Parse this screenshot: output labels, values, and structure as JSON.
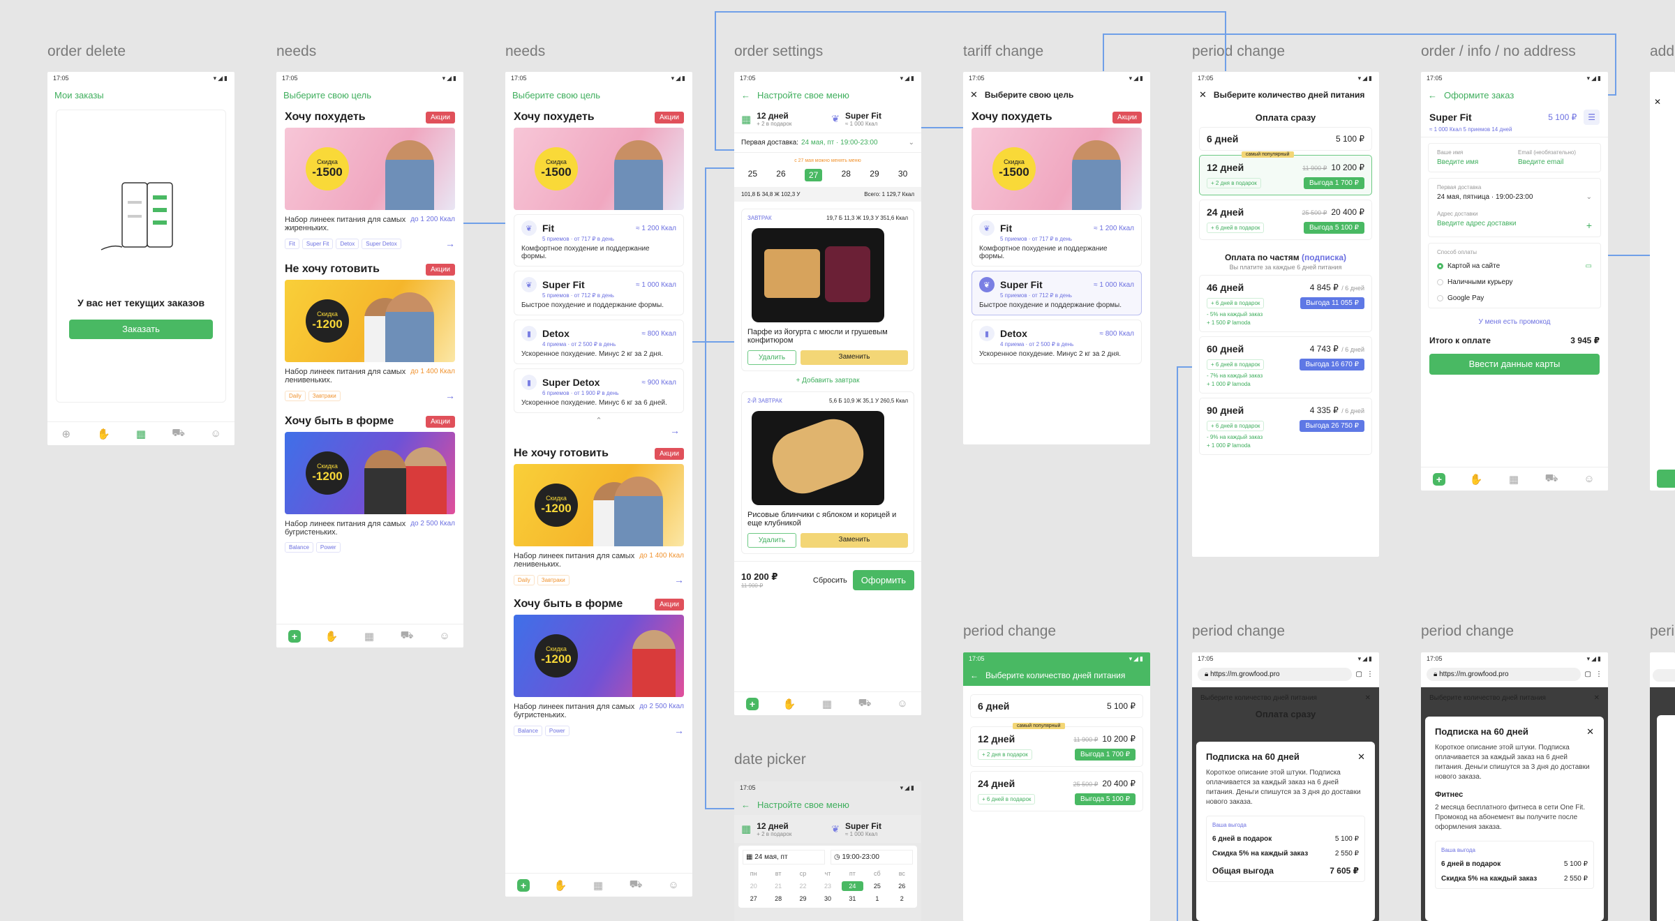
{
  "labels": {
    "f1": "order delete",
    "f2": "needs",
    "f3": "needs",
    "f4": "order settings",
    "f5": "tariff change",
    "f6": "period change",
    "f7": "order / info / no address",
    "f8": "add",
    "f9": "period change",
    "f10": "period change",
    "f11": "period change",
    "f12": "peri",
    "f13": "date picker"
  },
  "status": {
    "time": "17:05",
    "icons": "▾◢▮"
  },
  "colors": {
    "accent": "#49b963",
    "promo": "#e0505a",
    "violet": "#6b6fe0"
  },
  "orders": {
    "title": "Мои заказы",
    "empty": "У вас нет текущих заказов",
    "cta": "Заказать"
  },
  "needs": {
    "title": "Выберите свою цель",
    "promo": "Акции",
    "sections": [
      {
        "title": "Хочу похудеть",
        "disc_label": "Скидка",
        "disc": "-1500",
        "desc": "Набор линеек питания для самых жиренньких.",
        "kcal": "до 1 200 Ккал",
        "chips": [
          "Fit",
          "Super Fit",
          "Detox",
          "Super Detox"
        ]
      },
      {
        "title": "Не хочу готовить",
        "disc_label": "Скидка",
        "disc": "-1200",
        "desc": "Набор линеек питания для самых ленивеньких.",
        "kcal": "до 1 400 Ккал",
        "chips": [
          "Daily",
          "Завтраки"
        ]
      },
      {
        "title": "Хочу быть в форме",
        "disc_label": "Скидка",
        "disc": "-1200",
        "desc": "Набор линеек питания для самых бугристеньких.",
        "kcal": "до 2 500 Ккал",
        "chips": [
          "Balance",
          "Power"
        ]
      }
    ],
    "plans": [
      {
        "name": "Fit",
        "kcal": "≈ 1 200 Ккал",
        "meta": "5 приемов · от 717 ₽ в день",
        "text": "Комфортное похудение и поддержание формы."
      },
      {
        "name": "Super Fit",
        "kcal": "≈ 1 000 Ккал",
        "meta": "5 приемов · от 712 ₽ в день",
        "text": "Быстрое похудение и поддержание формы."
      },
      {
        "name": "Detox",
        "kcal": "≈ 800 Ккал",
        "meta": "4 приема · от 2 500 ₽ в день",
        "text": "Ускоренное похудение. Минус 2 кг за 2 дня."
      },
      {
        "name": "Super Detox",
        "kcal": "≈ 900 Ккал",
        "meta": "6 приемов · от 1 900 ₽ в день",
        "text": "Ускоренное похудение. Минус 6 кг за 6 дней."
      }
    ]
  },
  "settings": {
    "title": "Настройте свое меню",
    "days": "12 дней",
    "days_sub": "+ 2 в подарок",
    "plan": "Super Fit",
    "plan_sub": "≈ 1 000 Ккал",
    "first_label": "Первая доставка:",
    "first_val": "24 мая, пт · 19:00-23:00",
    "hint": "с 27 мая можно менять меню",
    "dates": [
      "25",
      "26",
      "27",
      "28",
      "29",
      "30"
    ],
    "macros": "101,8 Б   34,8 Ж   102,3 У",
    "total": "Всего: 1 129,7 Ккал",
    "meal1": "ЗАВТРАК",
    "meal1_macros": "19,7 Б  11,3 Ж  19,3 У     351,6 Ккал",
    "meal1_name": "Парфе из йогурта с мюсли и грушевым конфитюром",
    "meal2": "2-Й ЗАВТРАК",
    "meal2_macros": "5,6 Б  10,9 Ж  35,1 У     260,5 Ккал",
    "meal2_name": "Рисовые блинчики с яблоком и корицей и еще клубникой",
    "remove": "Удалить",
    "replace": "Заменить",
    "add": "+ Добавить завтрак",
    "price": "10 200 ₽",
    "old": "11 900 ₽",
    "reset": "Сбросить",
    "order": "Оформить"
  },
  "period": {
    "title": "Выберите количество дней питания",
    "pay_now": "Оплата сразу",
    "popular": "самый популярный",
    "now": [
      {
        "d": "6 дней",
        "p": "5 100 ₽",
        "old": "",
        "gift": "",
        "profit": ""
      },
      {
        "d": "12 дней",
        "p": "10 200 ₽",
        "old": "11 900 ₽",
        "gift": "+ 2 дня в подарок",
        "profit": "Выгода 1 700 ₽"
      },
      {
        "d": "24 дней",
        "p": "20 400 ₽",
        "old": "25 500 ₽",
        "gift": "+ 6 дней в подарок",
        "profit": "Выгода 5 100 ₽"
      }
    ],
    "pay_parts": "Оплата по частям",
    "sub_link": "(подписка)",
    "pay_parts_sub": "Вы платите за каждые 6 дней питания",
    "parts": [
      {
        "d": "46 дней",
        "p": "4 845 ₽",
        "per": "/ 6 дней",
        "gift": "+ 6 дней в подарок",
        "disc": "- 5% на каждый заказ",
        "bonus": "+ 1 500 ₽ lamoda",
        "profit": "Выгода 11 055 ₽"
      },
      {
        "d": "60 дней",
        "p": "4 743 ₽",
        "per": "/ 6 дней",
        "gift": "+ 6 дней в подарок",
        "disc": "- 7% на каждый заказ",
        "bonus": "+ 1 000 ₽ lamoda",
        "profit": "Выгода 16 670 ₽"
      },
      {
        "d": "90 дней",
        "p": "4 335 ₽",
        "per": "/ 6 дней",
        "gift": "+ 6 дней в подарок",
        "disc": "- 9% на каждый заказ",
        "bonus": "+ 1 000 ₽ lamoda",
        "profit": "Выгода 26 750 ₽"
      }
    ]
  },
  "checkout": {
    "title": "Оформите заказ",
    "plan": "Super Fit",
    "price": "5 100 ₽",
    "meta": "≈ 1 000 Ккал   5 приемов   14 дней",
    "name_label": "Ваше имя",
    "name_ph": "Введите имя",
    "email_label": "Email (необязательно)",
    "email_ph": "Введите email",
    "first_label": "Первая доставка",
    "first_val": "24 мая, пятница · 19:00-23:00",
    "addr_label": "Адрес доставки",
    "addr_ph": "Введите адрес доставки",
    "pay_label": "Способ оплаты",
    "pay1": "Картой на сайте",
    "pay2": "Наличными курьеру",
    "pay3": "Google Pay",
    "promo": "У меня есть промокод",
    "total_label": "Итого к оплате",
    "total": "3 945 ₽",
    "cta": "Ввести данные карты"
  },
  "browser": {
    "url": "https://m.growfood.pro",
    "modal_title": "Подписка на 60 дней",
    "modal_text": "Короткое описание этой штуки. Подписка оплачивается за каждый заказ на 6 дней питания. Деньги спишутся за 3 дня до доставки нового заказа.",
    "benefit": "Ваша выгода",
    "b1": "6 дней в подарок",
    "b1v": "5 100 ₽",
    "b2": "Скидка 5% на каждый заказ",
    "b2v": "2 550 ₽",
    "b3": "Общая выгода",
    "b3v": "7 605 ₽",
    "fitness": "Фитнес",
    "fitness_text": "2 месяца бесплатного фитнеса в сети One Fit. Промокод на абонемент вы получите после оформления заказа."
  },
  "picker": {
    "date": "24 мая, пт",
    "time": "19:00-23:00",
    "weekdays": [
      "пн",
      "вт",
      "ср",
      "чт",
      "пт",
      "сб",
      "вс"
    ],
    "row1": [
      "20",
      "21",
      "22",
      "23",
      "24",
      "25",
      "26"
    ],
    "row2": [
      "27",
      "28",
      "29",
      "30",
      "31",
      "1",
      "2"
    ]
  }
}
